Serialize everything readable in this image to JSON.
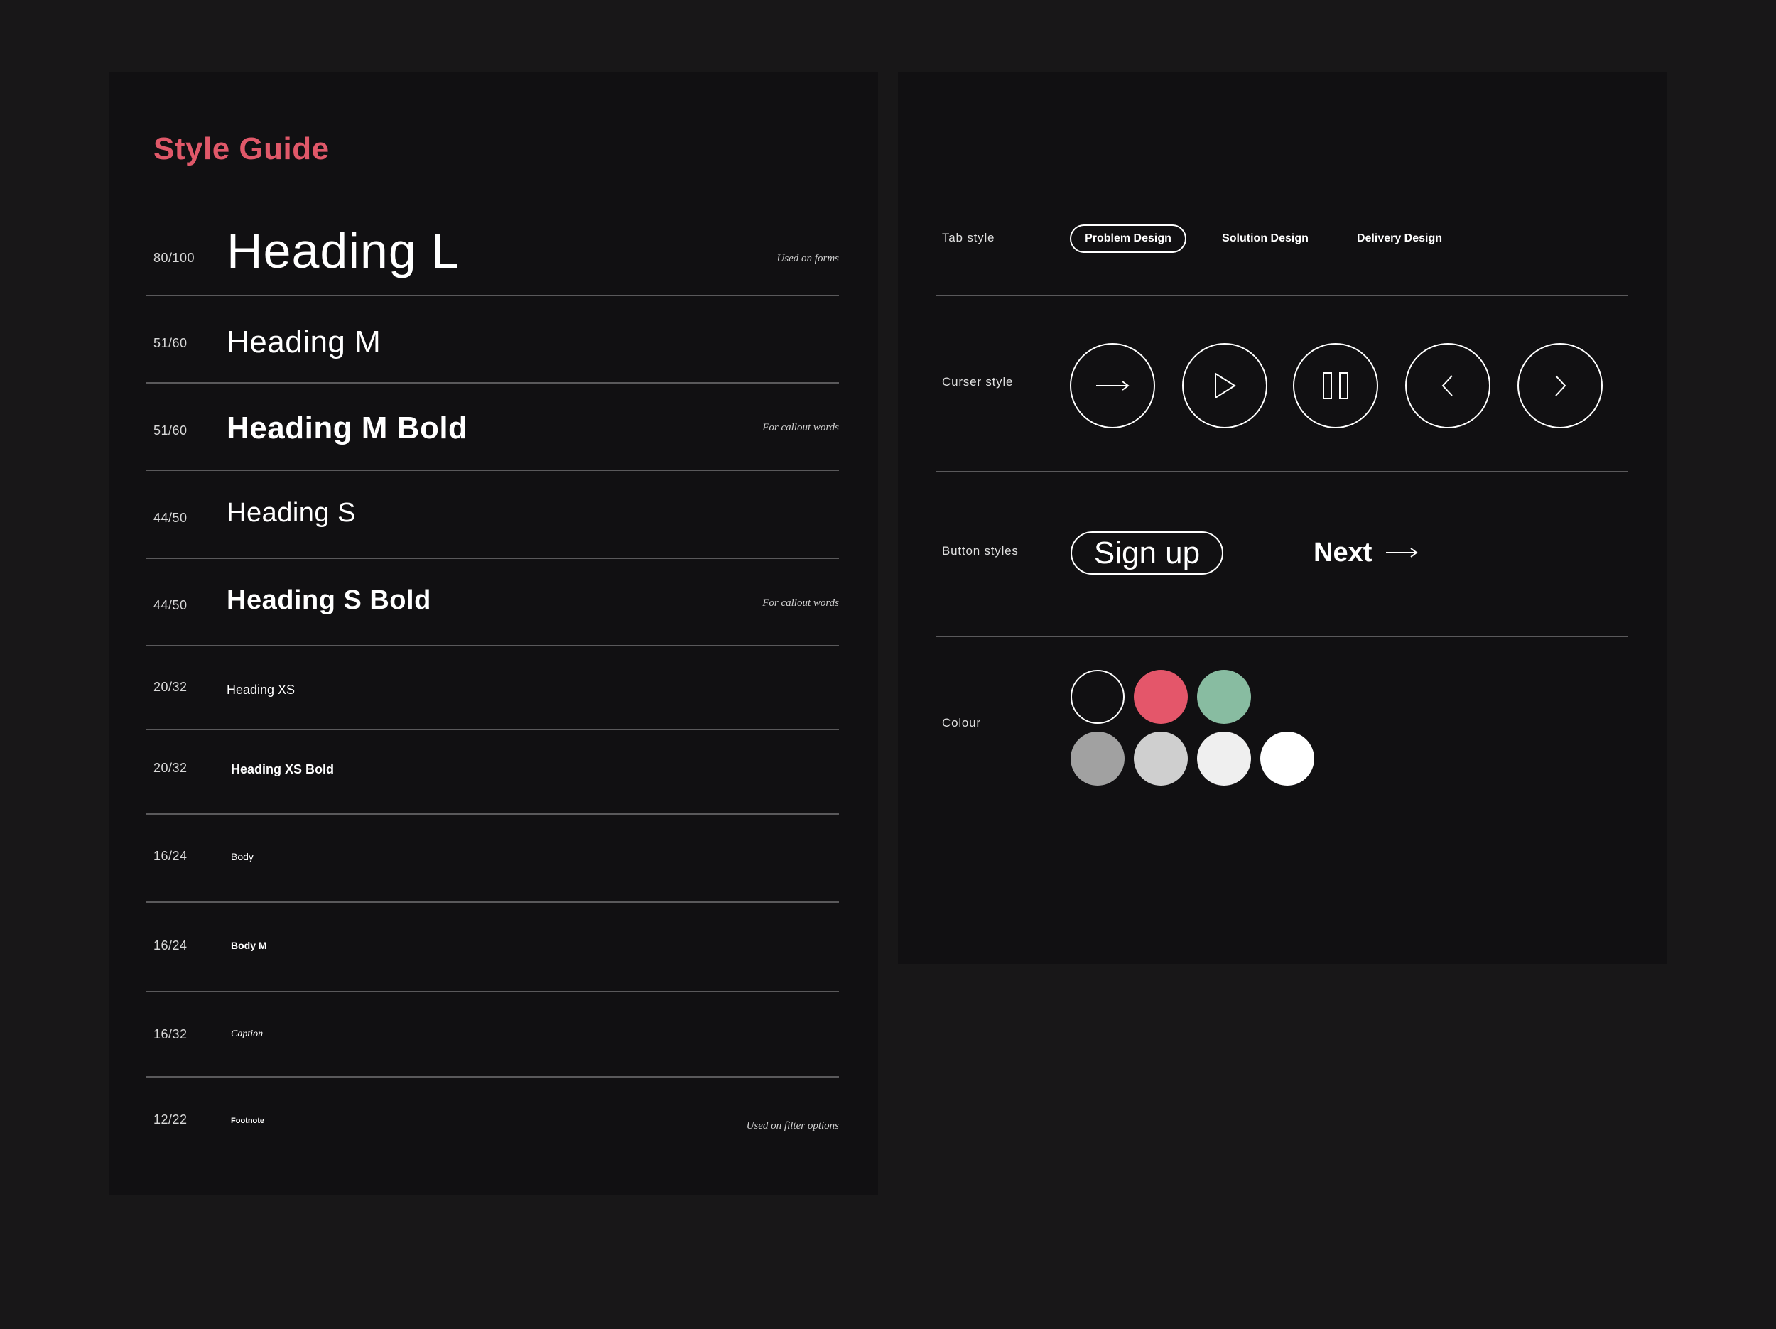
{
  "style_guide": {
    "title": "Style Guide",
    "rows": [
      {
        "size": "80/100",
        "sample": "Heading L",
        "note": "Used on forms"
      },
      {
        "size": "51/60",
        "sample": "Heading M",
        "note": ""
      },
      {
        "size": "51/60",
        "sample": "Heading M Bold",
        "note": "For callout words"
      },
      {
        "size": "44/50",
        "sample": "Heading S",
        "note": ""
      },
      {
        "size": "44/50",
        "sample": "Heading S Bold",
        "note": "For callout words"
      },
      {
        "size": "20/32",
        "sample": "Heading XS",
        "note": ""
      },
      {
        "size": "20/32",
        "sample": "Heading XS Bold",
        "note": ""
      },
      {
        "size": "16/24",
        "sample": "Body",
        "note": ""
      },
      {
        "size": "16/24",
        "sample": "Body M",
        "note": ""
      },
      {
        "size": "16/32",
        "sample": "Caption",
        "note": ""
      },
      {
        "size": "12/22",
        "sample": "Footnote",
        "note": "Used on filter options"
      }
    ]
  },
  "components": {
    "tab_style": {
      "label": "Tab style",
      "tabs": [
        "Problem Design",
        "Solution Design",
        "Delivery Design"
      ],
      "active": "Problem Design"
    },
    "cursor_style": {
      "label": "Curser style",
      "icons": [
        "arrow-right-icon",
        "play-icon",
        "pause-icon",
        "chevron-left-icon",
        "chevron-right-icon"
      ]
    },
    "button_styles": {
      "label": "Button styles",
      "primary_label": "Sign up",
      "link_label": "Next",
      "link_icon": "arrow-right-icon"
    },
    "colour": {
      "label": "Colour",
      "swatches": [
        "#111012",
        "#e4566a",
        "#88bca1",
        "#a1a1a1",
        "#cfcfcf",
        "#efefef",
        "#ffffff"
      ]
    }
  },
  "colors": {
    "background": "#181718",
    "panel": "#111012",
    "accent": "#e05869"
  }
}
